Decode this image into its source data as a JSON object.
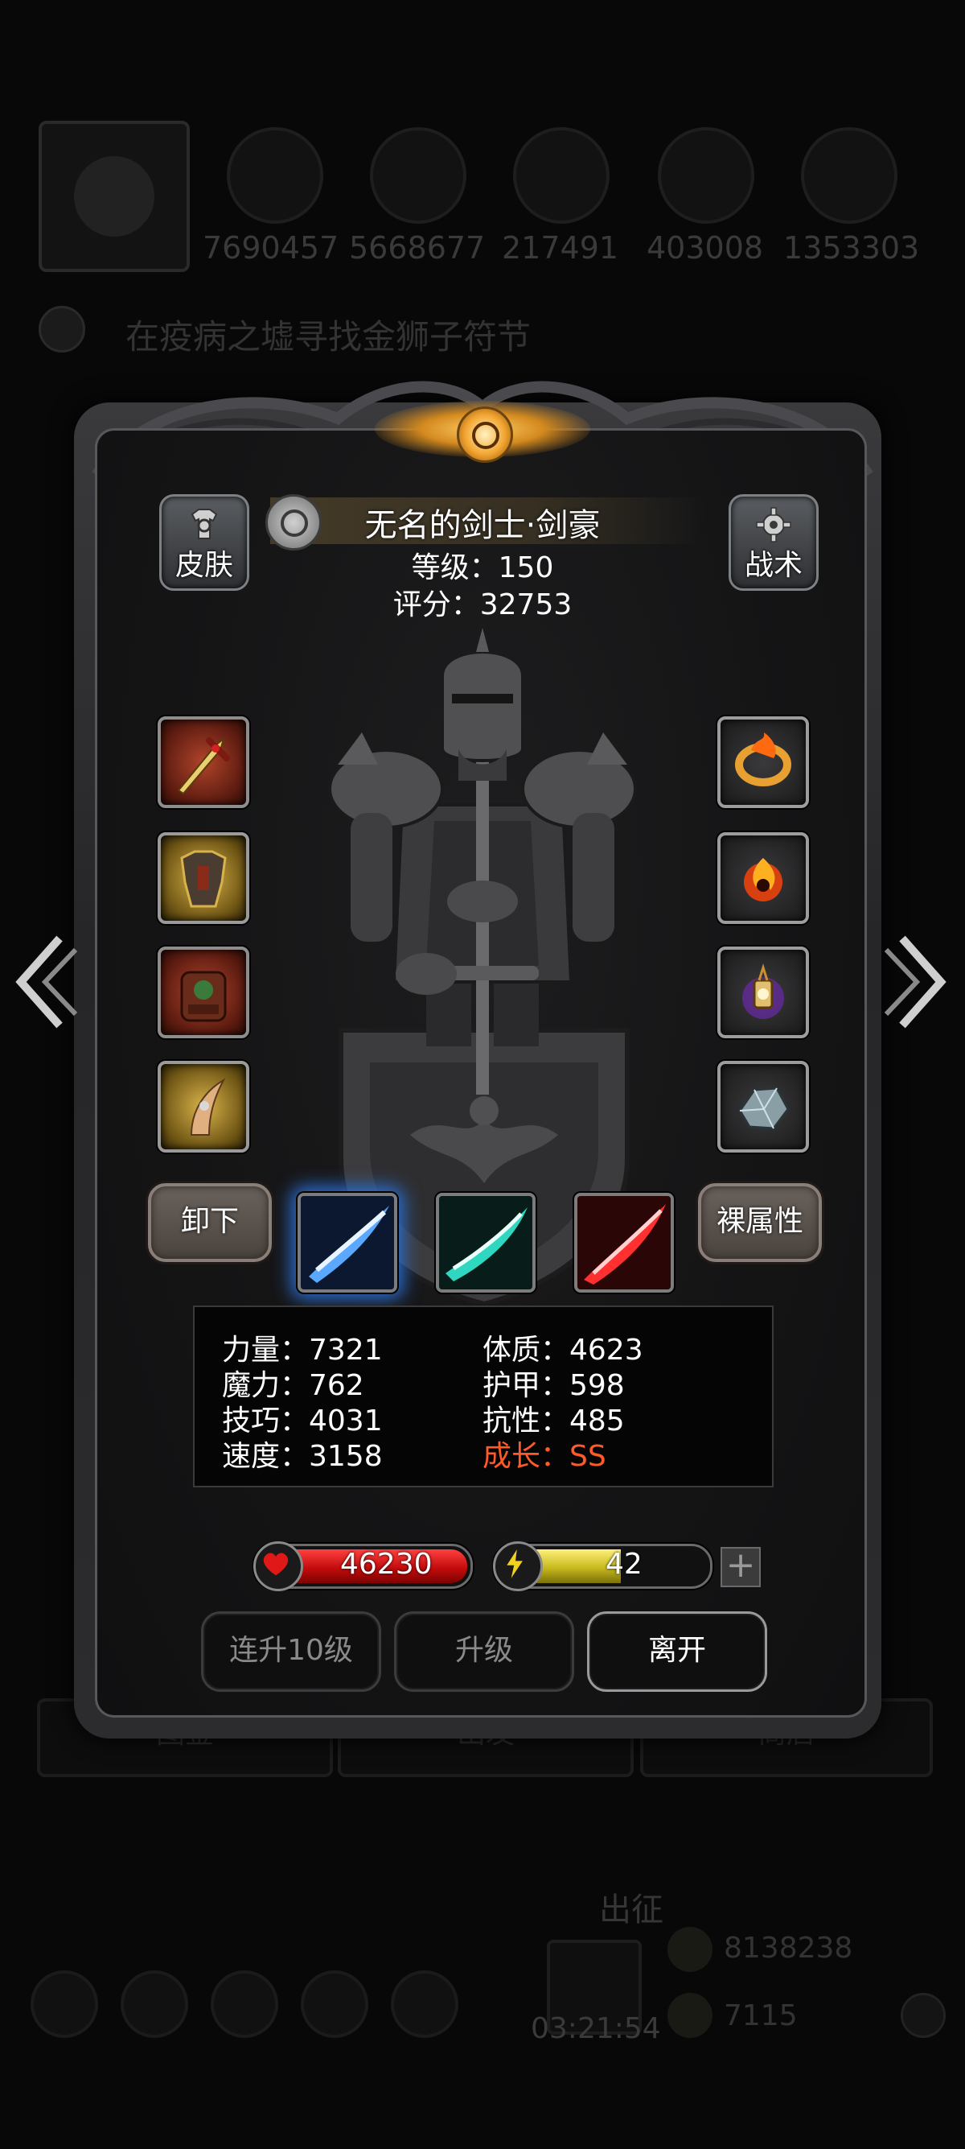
{
  "background": {
    "resource_values": [
      "7690457",
      "5668677",
      "217491",
      "403008",
      "1353303"
    ],
    "quest_text": "在疫病之墟寻找金狮子符节",
    "bottom_tabs": [
      "图鉴",
      "出发",
      "商店"
    ],
    "go_label": "出征",
    "timer": "03:21:54",
    "coin_value": "8138238",
    "gem_value": "7115"
  },
  "header": {
    "skin_label": "皮肤",
    "tactics_label": "战术",
    "hero_name": "无名的剑士·剑豪",
    "level_text": "等级：150",
    "score_text": "评分：32753"
  },
  "equipment": {
    "left": [
      "sword-icon",
      "chest-armor-icon",
      "backpack-icon",
      "claw-icon"
    ],
    "right": [
      "fire-ring-icon",
      "fire-orb-icon",
      "lantern-icon",
      "crystal-ore-icon"
    ]
  },
  "actions": {
    "unequip_label": "卸下",
    "base_stats_label": "裸属性",
    "skills": [
      {
        "name": "blue-slash-skill",
        "color": "#2f7ae0"
      },
      {
        "name": "teal-slash-skill",
        "color": "#1fa89a"
      },
      {
        "name": "red-slash-skill",
        "color": "#d02424"
      }
    ]
  },
  "stats": {
    "left": [
      "力量：7321",
      "魔力：762",
      "技巧：4031",
      "速度：3158"
    ],
    "right": [
      "体质：4623",
      "护甲：598",
      "抗性：485",
      "成长：SS"
    ]
  },
  "bars": {
    "hp_value": "46230",
    "energy_value": "42",
    "energy_fraction": 0.5,
    "hp_color": "#d01010",
    "energy_color": "#d8c82a"
  },
  "buttons": {
    "level_up_10": "连升10级",
    "level_up": "升级",
    "leave": "离开"
  }
}
